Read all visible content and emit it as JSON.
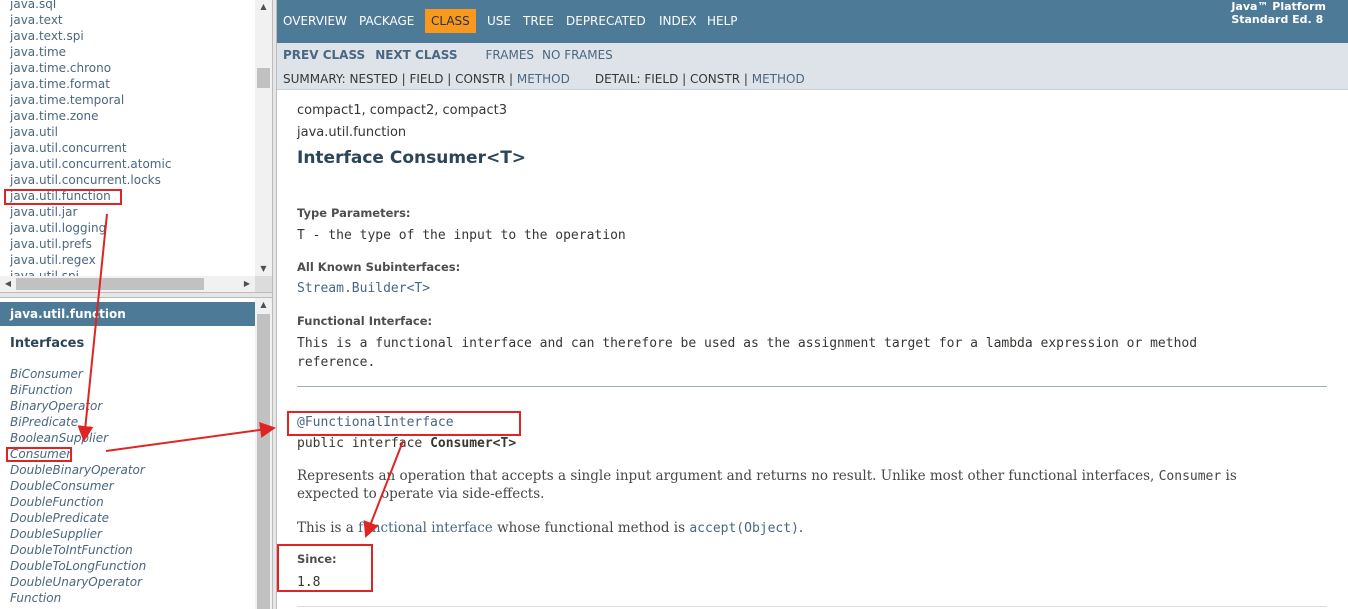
{
  "packages": [
    "java.sql",
    "java.text",
    "java.text.spi",
    "java.time",
    "java.time.chrono",
    "java.time.format",
    "java.time.temporal",
    "java.time.zone",
    "java.util",
    "java.util.concurrent",
    "java.util.concurrent.atomic",
    "java.util.concurrent.locks",
    "java.util.function",
    "java.util.jar",
    "java.util.logging",
    "java.util.prefs",
    "java.util.regex",
    "java.util.spi"
  ],
  "class_frame": {
    "header": "java.util.function",
    "section": "Interfaces",
    "interfaces": [
      "BiConsumer",
      "BiFunction",
      "BinaryOperator",
      "BiPredicate",
      "BooleanSupplier",
      "Consumer",
      "DoubleBinaryOperator",
      "DoubleConsumer",
      "DoubleFunction",
      "DoublePredicate",
      "DoubleSupplier",
      "DoubleToIntFunction",
      "DoubleToLongFunction",
      "DoubleUnaryOperator",
      "Function"
    ]
  },
  "topnav": {
    "items": [
      "OVERVIEW",
      "PACKAGE",
      "CLASS",
      "USE",
      "TREE",
      "DEPRECATED",
      "INDEX",
      "HELP"
    ],
    "active": "CLASS",
    "platform_line1": "Java™ Platform",
    "platform_line2": "Standard Ed. 8"
  },
  "subnav": {
    "prev_class": "PREV CLASS",
    "next_class": "NEXT CLASS",
    "frames": "FRAMES",
    "no_frames": "NO FRAMES",
    "summary_prefix": "SUMMARY: NESTED | FIELD | CONSTR | ",
    "summary_method": "METHOD",
    "detail_prefix": "DETAIL: FIELD | CONSTR | ",
    "detail_method": "METHOD"
  },
  "content": {
    "profiles": "compact1, compact2, compact3",
    "package": "java.util.function",
    "title": "Interface Consumer<T>",
    "type_params_label": "Type Parameters:",
    "type_params_value": "T - the type of the input to the operation",
    "subinterfaces_label": "All Known Subinterfaces:",
    "subinterfaces_value": "Stream.Builder<T>",
    "functional_label": "Functional Interface:",
    "functional_line1": "This is a functional interface and can therefore be used as the assignment target for a lambda expression or method",
    "functional_line2": "reference.",
    "annotation": "@FunctionalInterface",
    "decl_prefix": "public interface ",
    "decl_name": "Consumer<T>",
    "desc_line1_a": "Represents an operation that accepts a single input argument and returns no result. Unlike most other functional interfaces, ",
    "desc_line1_code": "Consumer",
    "desc_line1_b": " is",
    "desc_line2": "expected to operate via side-effects.",
    "fi_text_a": "This is a ",
    "fi_link": "functional interface",
    "fi_text_b": " whose functional method is ",
    "fi_method": "accept(Object)",
    "fi_text_c": ".",
    "since_label": "Since:",
    "since_value": "1.8"
  },
  "annotation_color": "#e02424"
}
